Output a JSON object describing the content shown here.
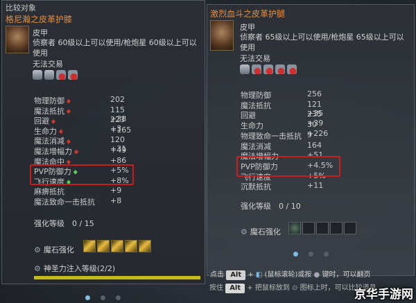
{
  "left": {
    "header": "比较对象",
    "item_name": "格尼瀚之皮革护膝",
    "type": "皮甲",
    "requirement": "侦察者 60级以上可以使用/枪炮星 60级以上可以使用",
    "trade": "无法交易",
    "stats": [
      {
        "label": "物理防御",
        "value": "202",
        "mark": "red"
      },
      {
        "label": "魔法抵抗",
        "value": "115 +38",
        "mark": "red"
      },
      {
        "label": "回避",
        "value": "223 +3",
        "mark": "red"
      },
      {
        "label": "生命力",
        "value": "+165",
        "mark": "red"
      },
      {
        "label": "魔法消减",
        "value": "120 +31",
        "mark": "red"
      },
      {
        "label": "魔法增幅力",
        "value": "+49",
        "mark": "red"
      },
      {
        "label": "魔法命中",
        "value": "+86",
        "mark": "red"
      },
      {
        "label": "PVP防御力",
        "value": "+5%",
        "mark": "green"
      },
      {
        "label": "飞行速度",
        "value": "+8%",
        "mark": "green"
      },
      {
        "label": "麻痹抵抗",
        "value": "+9",
        "mark": ""
      },
      {
        "label": "魔法致命一击抵抗",
        "value": "+8",
        "mark": ""
      }
    ],
    "enhance": "强化等级　0 / 15",
    "stone_label": "魔石强化",
    "divine_label": "神圣力注入等级(2/2)"
  },
  "right": {
    "item_name": "激烈血斗之皮革护腿",
    "type": "皮甲",
    "requirement": "侦察者 65级以上可以使用/枪炮星 65级以上可以使用",
    "trade": "无法交易",
    "stats": [
      {
        "label": "物理防御",
        "value": "256"
      },
      {
        "label": "魔法抵抗",
        "value": "121 +35"
      },
      {
        "label": "回避",
        "value": "235 +39"
      },
      {
        "label": "生命力",
        "value": "30 +226"
      },
      {
        "label": "物理致命一击抵抗",
        "value": "9"
      },
      {
        "label": "魔法消减",
        "value": "164"
      },
      {
        "label": "魔法增幅力",
        "value": "+51"
      },
      {
        "label": "PVP防御力",
        "value": "+4.5%"
      },
      {
        "label": "飞行速度",
        "value": "+5%"
      },
      {
        "label": "沉默抵抗",
        "value": "+11"
      }
    ],
    "enhance": "强化等级　0 / 10",
    "stone_label": "魔石强化",
    "hint1_pre": "点击",
    "hint1_key": "Alt",
    "hint1_mid": "+",
    "hint1_post": "(鼠标滚轮)或按",
    "hint1_end": "键时，可以翻页",
    "hint2_pre": "按住",
    "hint2_key": "Alt",
    "hint2_post": "+ 把鼠标放到",
    "hint2_end": "图标上时，可以比较道具"
  },
  "watermark": "京华手游网",
  "colors": {
    "title": "#e4924a",
    "highlight": "#d11c1c",
    "down": "#d23a2a",
    "up": "#5bd35b"
  }
}
